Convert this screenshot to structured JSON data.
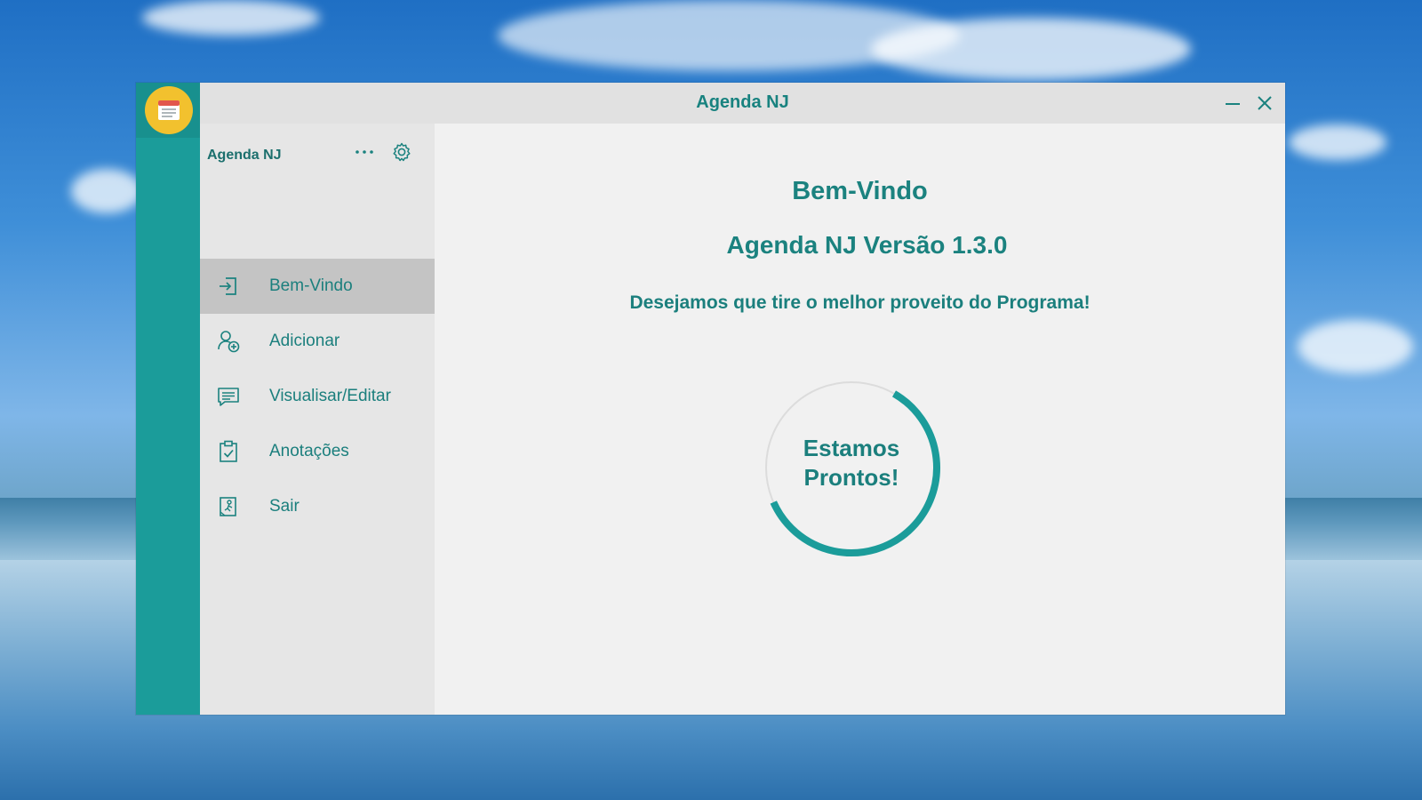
{
  "window": {
    "title": "Agenda NJ",
    "accent_color": "#1b9c9a",
    "app_icon": "notepad-icon",
    "controls": {
      "minimize_icon": "minimize-icon",
      "close_icon": "close-icon"
    }
  },
  "sidebar": {
    "app_name": "Agenda NJ",
    "more_icon": "more-dots-icon",
    "settings_icon": "gear-icon",
    "items": [
      {
        "label": "Bem-Vindo",
        "icon": "sign-in-icon",
        "active": true
      },
      {
        "label": "Adicionar",
        "icon": "add-person-icon",
        "active": false
      },
      {
        "label": "Visualisar/Editar",
        "icon": "message-icon",
        "active": false
      },
      {
        "label": "Anotações",
        "icon": "clipboard-check-icon",
        "active": false
      },
      {
        "label": "Sair",
        "icon": "exit-icon",
        "active": false
      }
    ]
  },
  "main": {
    "welcome": "Bem-Vindo",
    "version": "Agenda NJ Versão 1.3.0",
    "tagline": "Desejamos que tire o melhor proveito do Programa!",
    "progress": {
      "line1": "Estamos",
      "line2": "Prontos!",
      "fraction": 0.6
    }
  }
}
